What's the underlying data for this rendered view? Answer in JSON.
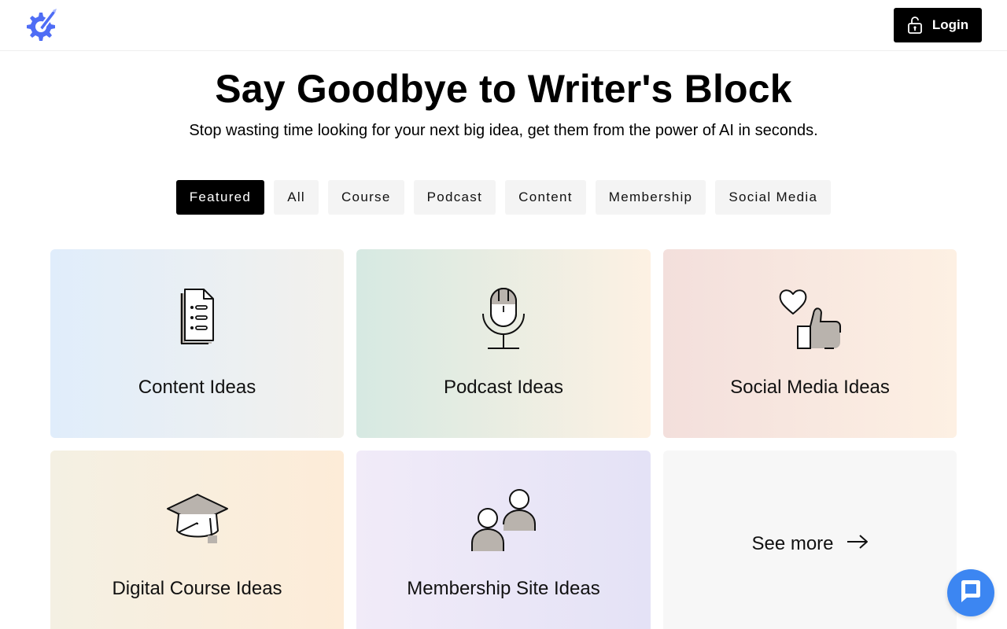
{
  "header": {
    "login_label": "Login"
  },
  "hero": {
    "title": "Say Goodbye to Writer's Block",
    "subtitle": "Stop wasting time looking for your next big idea, get them from the power of AI in seconds."
  },
  "tabs": [
    {
      "label": "Featured",
      "active": true
    },
    {
      "label": "All",
      "active": false
    },
    {
      "label": "Course",
      "active": false
    },
    {
      "label": "Podcast",
      "active": false
    },
    {
      "label": "Content",
      "active": false
    },
    {
      "label": "Membership",
      "active": false
    },
    {
      "label": "Social Media",
      "active": false
    }
  ],
  "cards": [
    {
      "label": "Content Ideas",
      "icon": "document-list-icon"
    },
    {
      "label": "Podcast Ideas",
      "icon": "microphone-icon"
    },
    {
      "label": "Social Media Ideas",
      "icon": "heart-thumbs-up-icon"
    },
    {
      "label": "Digital Course Ideas",
      "icon": "graduation-cap-icon"
    },
    {
      "label": "Membership Site Ideas",
      "icon": "people-icon"
    }
  ],
  "see_more": {
    "label": "See more",
    "icon": "arrow-right-icon"
  },
  "colors": {
    "brand": "#4f6df5",
    "chat": "#3c86f2",
    "active_tab": "#000000"
  }
}
